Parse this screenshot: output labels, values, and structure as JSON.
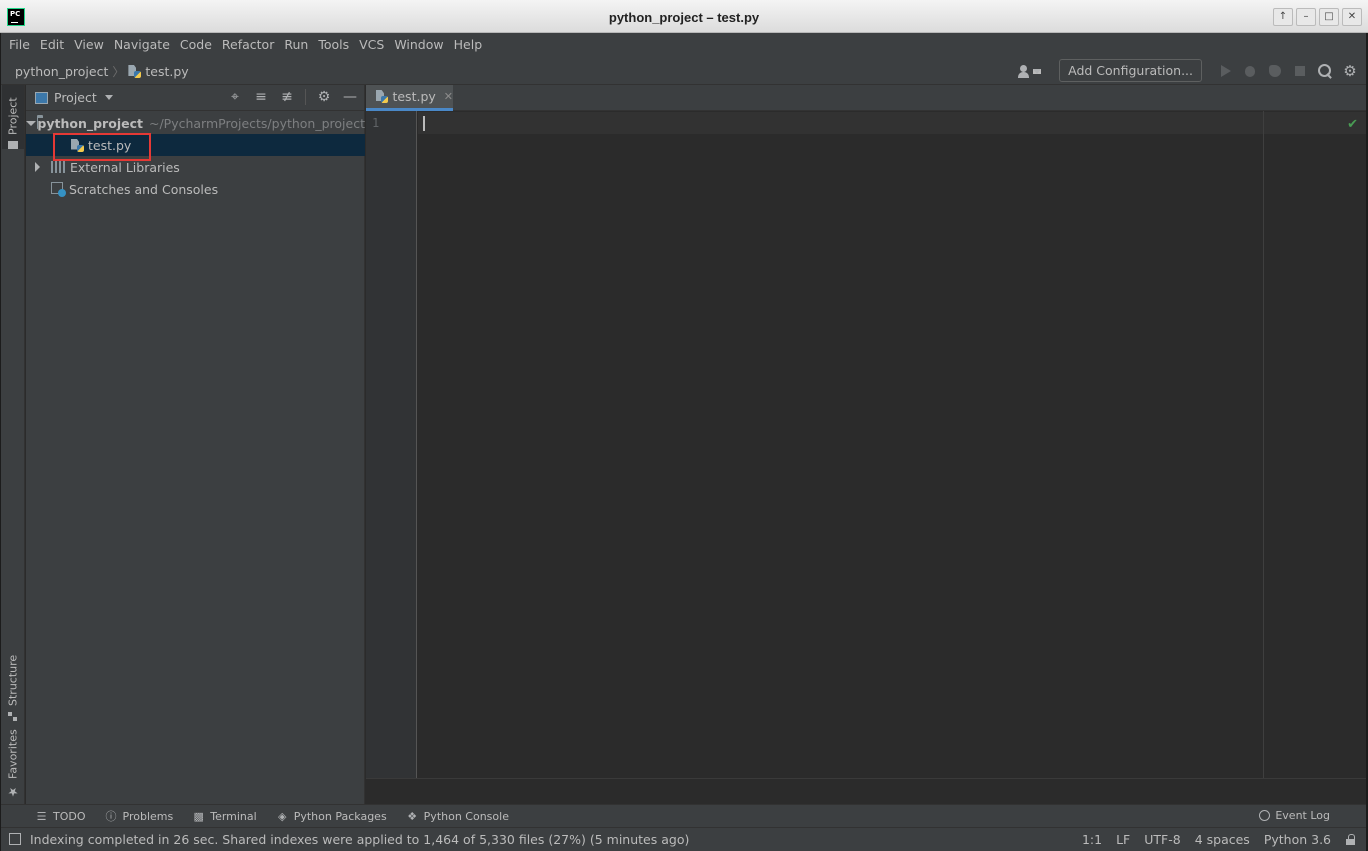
{
  "window": {
    "title": "python_project – test.py",
    "app_icon_text": "PC",
    "controls": [
      "up-arrow",
      "minimize",
      "maximize",
      "close"
    ]
  },
  "menu": {
    "items": [
      {
        "label": "File"
      },
      {
        "label": "Edit"
      },
      {
        "label": "View"
      },
      {
        "label": "Navigate"
      },
      {
        "label": "Code"
      },
      {
        "label": "Refactor"
      },
      {
        "label": "Run"
      },
      {
        "label": "Tools"
      },
      {
        "label": "VCS"
      },
      {
        "label": "Window"
      },
      {
        "label": "Help"
      }
    ]
  },
  "navbar": {
    "breadcrumb_project": "python_project",
    "breadcrumb_file": "test.py",
    "add_configuration_label": "Add Configuration..."
  },
  "left_strip": {
    "project_tab": "Project",
    "structure_tab": "Structure",
    "favorites_tab": "Favorites"
  },
  "project_panel": {
    "title": "Project",
    "tree": {
      "root_name": "python_project",
      "root_path": "~/PycharmProjects/python_project",
      "file_name": "test.py",
      "external_libraries": "External Libraries",
      "scratches": "Scratches and Consoles"
    }
  },
  "editor": {
    "tab_label": "test.py",
    "line_number": "1"
  },
  "bottom_tools": {
    "todo": "TODO",
    "problems": "Problems",
    "terminal": "Terminal",
    "python_packages": "Python Packages",
    "python_console": "Python Console",
    "event_log": "Event Log"
  },
  "status": {
    "message": "Indexing completed in 26 sec. Shared indexes were applied to 1,464 of 5,330 files (27%) (5 minutes ago)",
    "position": "1:1",
    "line_separator": "LF",
    "encoding": "UTF-8",
    "indent": "4 spaces",
    "interpreter": "Python 3.6"
  },
  "colors": {
    "accent": "#4a88c7",
    "selection": "#0d293e",
    "highlight_box": "#e53935",
    "ok_check": "#499c54"
  }
}
